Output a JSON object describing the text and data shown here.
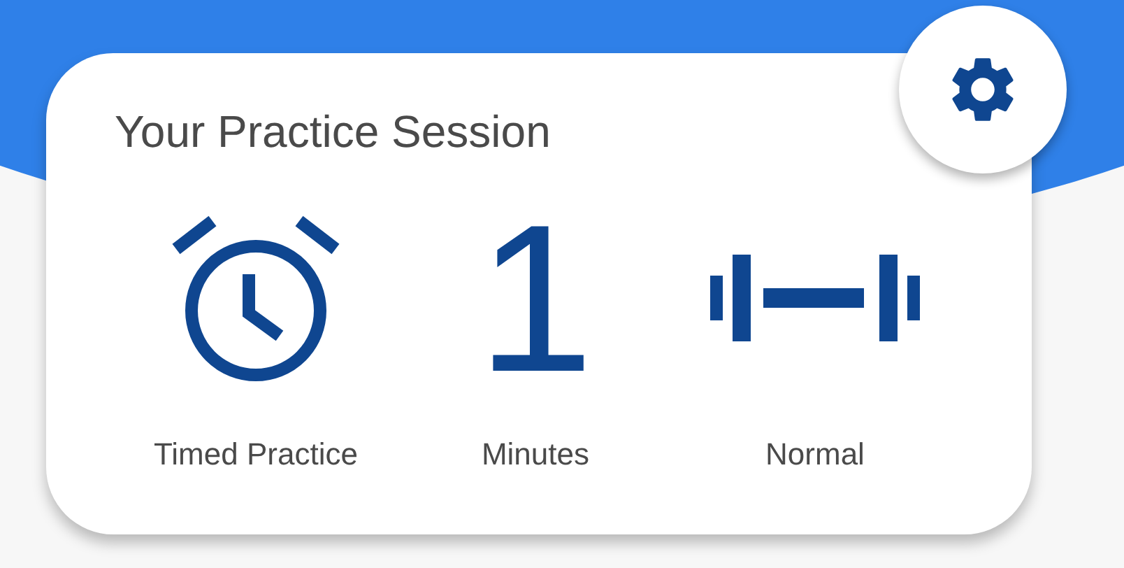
{
  "card": {
    "title": "Your Practice Session"
  },
  "items": [
    {
      "kind": "timer",
      "label": "Timed Practice"
    },
    {
      "kind": "value",
      "value": "1",
      "label": "Minutes"
    },
    {
      "kind": "dumbbell",
      "label": "Normal"
    }
  ]
}
